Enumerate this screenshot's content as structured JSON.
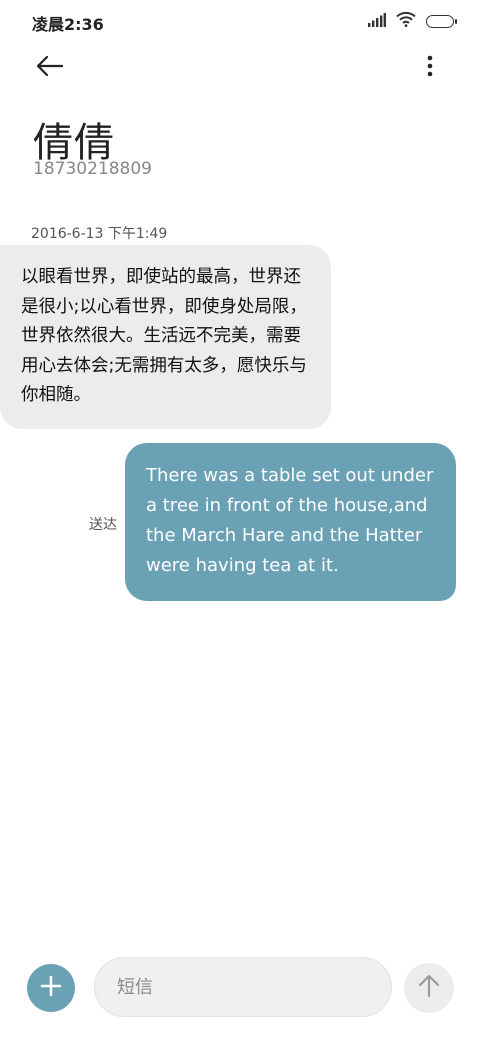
{
  "status_bar": {
    "time": "凌晨2:36",
    "icons": [
      "signal-icon",
      "wifi-icon",
      "battery-icon"
    ]
  },
  "header": {
    "back_icon": "back-arrow-icon",
    "menu_icon": "more-vertical-icon"
  },
  "contact": {
    "name": "倩倩",
    "number": "18730218809"
  },
  "conversation": {
    "timestamp": "2016-6-13 下午1:49",
    "messages": [
      {
        "direction": "incoming",
        "text": "以眼看世界，即使站的最高，世界还是很小;以心看世界，即使身处局限，世界依然很大。生活远不完美，需要用心去体会;无需拥有太多，愿快乐与你相随。"
      },
      {
        "direction": "outgoing",
        "text": "There was a table set out under a tree in front of the house,and the March Hare and the Hatter were having tea at it.",
        "status": "送达"
      }
    ]
  },
  "composer": {
    "add_icon": "plus-icon",
    "placeholder": "短信",
    "value": "",
    "send_icon": "send-arrow-up-icon"
  },
  "colors": {
    "accent": "#6aa1b5",
    "incoming_bubble": "#ececec",
    "outgoing_text": "#ffffff",
    "background": "#ffffff"
  }
}
